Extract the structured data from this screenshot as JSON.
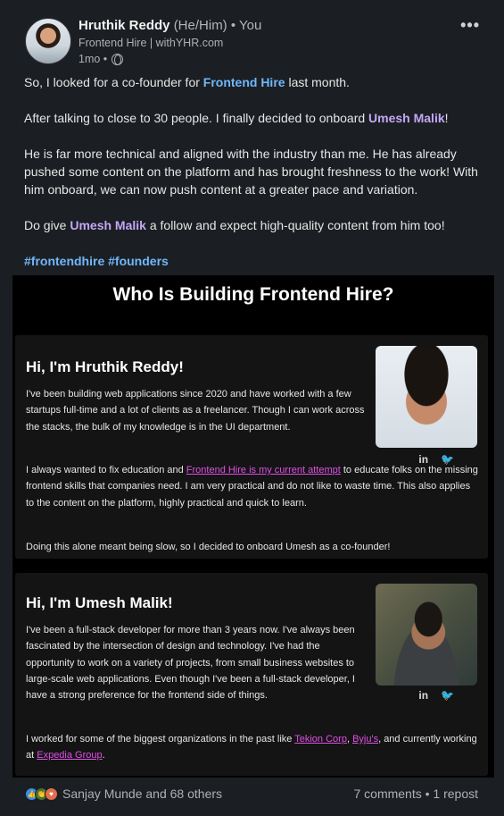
{
  "post": {
    "author_name": "Hruthik Reddy",
    "pronouns": "(He/Him)",
    "you_label": "• You",
    "headline": "Frontend Hire | withYHR.com",
    "time": "1mo •",
    "more_label": "•••",
    "p1_pre": "So, I looked for a co-founder for ",
    "p1_link": "Frontend Hire",
    "p1_post": " last month.",
    "p2_pre": "After talking to close to 30 people. I finally decided to onboard ",
    "p2_link": "Umesh Malik",
    "p2_post": "!",
    "p3": "He is far more technical and aligned with the industry than me. He has already pushed some content on the platform and has brought freshness to the work! With him onboard, we can now push content at a greater pace and variation.",
    "p4_pre": "Do give ",
    "p4_link": "Umesh Malik",
    "p4_post": " a follow and expect high-quality content from him too!",
    "hashtag1": "#frontendhire",
    "hashtag2": "#founders"
  },
  "embed": {
    "title": "Who Is Building Frontend Hire?",
    "panel1": {
      "heading": "Hi, I'm Hruthik Reddy!",
      "para1": "I've been building web applications since 2020 and have worked with a few startups full-time and a lot of clients as a freelancer. Though I can work across the stacks, the bulk of my knowledge is in the UI department.",
      "para2_pre": "I always wanted to fix education and ",
      "para2_link": "Frontend Hire is my current attempt",
      "para2_post": " to educate folks on the missing frontend skills that companies need. I am very practical and do not like to waste time. This also applies to the content on the platform, highly practical and quick to learn.",
      "para3": "Doing this alone meant being slow, so I decided to onboard Umesh as a co-founder!",
      "linkedin": "in",
      "twitter": "🐦"
    },
    "panel2": {
      "heading": "Hi, I'm Umesh Malik!",
      "para1": "I've been a full-stack developer for more than 3 years now. I've always been fascinated by the intersection of design and technology. I've had the opportunity to work on a variety of projects, from small business websites to large-scale web applications. Even though I've been a full-stack developer, I have a strong preference for the frontend side of things.",
      "para2_pre": "I worked for some of the biggest organizations in the past like ",
      "link1": "Tekion Corp",
      "sep1": ", ",
      "link2": "Byju's",
      "mid": ", and currently working at ",
      "link3": "Expedia Group",
      "end": ".",
      "linkedin": "in",
      "twitter": "🐦"
    }
  },
  "footer": {
    "reactors": "Sanjay Munde and 68 others",
    "counts": "7 comments • 1 repost"
  }
}
